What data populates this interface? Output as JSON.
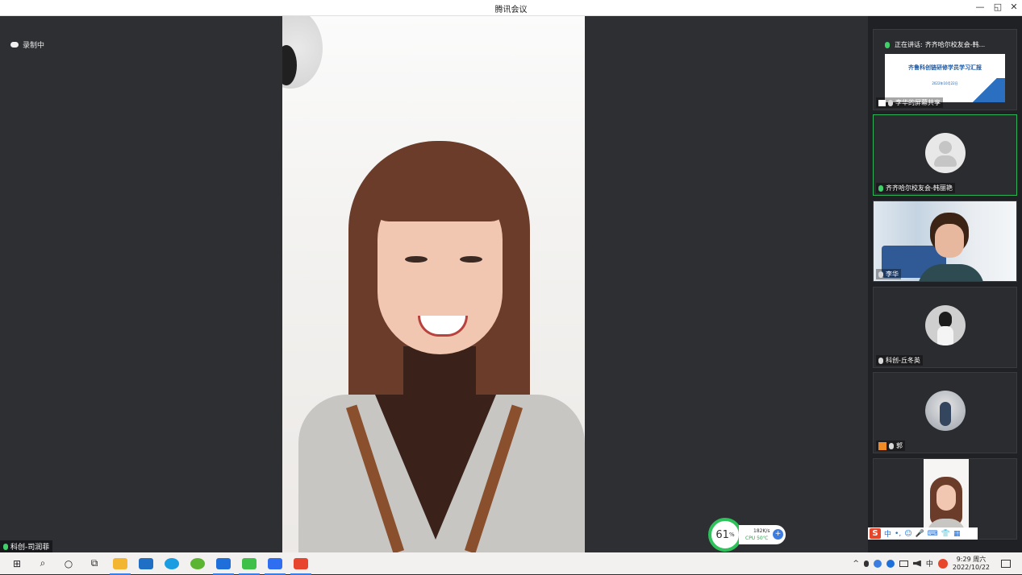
{
  "window": {
    "title": "腾讯会议",
    "minimize": "—",
    "restore": "◱",
    "close": "✕"
  },
  "recording": {
    "label": "录制中"
  },
  "main_speaker": {
    "name": "科创-司润菲"
  },
  "sidebar": {
    "speaking_prefix": "正在讲话:",
    "speaking_name": "齐齐哈尔校友会-韩...",
    "tiles": [
      {
        "type": "screen-share",
        "label": "李华的屏幕共享",
        "slide_title": "齐鲁科创链研修学员学习汇报",
        "slide_date": "2022年10月22日"
      },
      {
        "type": "avatar",
        "label": "齐齐哈尔校友会-韩丽艳",
        "active": true
      },
      {
        "type": "video",
        "label": "李华"
      },
      {
        "type": "photo",
        "label": "科创-丘冬英"
      },
      {
        "type": "photo",
        "label": "郭"
      },
      {
        "type": "video",
        "label": ""
      }
    ]
  },
  "netmon": {
    "cpu_percent": "61",
    "percent_sign": "%",
    "speed": "182K/s",
    "cpu_temp": "CPU 50℃",
    "plus": "+"
  },
  "ime": {
    "logo": "S",
    "mode": "中",
    "items": [
      "•,",
      "☺",
      "🎤",
      "⌨",
      "👕",
      "▦"
    ]
  },
  "taskbar": {
    "apps": [
      {
        "name": "start",
        "icon": "⊞"
      },
      {
        "name": "search",
        "icon": "⌕"
      },
      {
        "name": "cortana",
        "icon": "○"
      },
      {
        "name": "task-view",
        "icon": "⧉"
      }
    ],
    "tray": {
      "chevron": "^",
      "ime_mode": "中",
      "time": "9:29 周六",
      "date": "2022/10/22"
    }
  },
  "colors": {
    "active_border": "#2fb35a",
    "mic_active": "#3fd06a",
    "accent": "#3b7de0"
  }
}
